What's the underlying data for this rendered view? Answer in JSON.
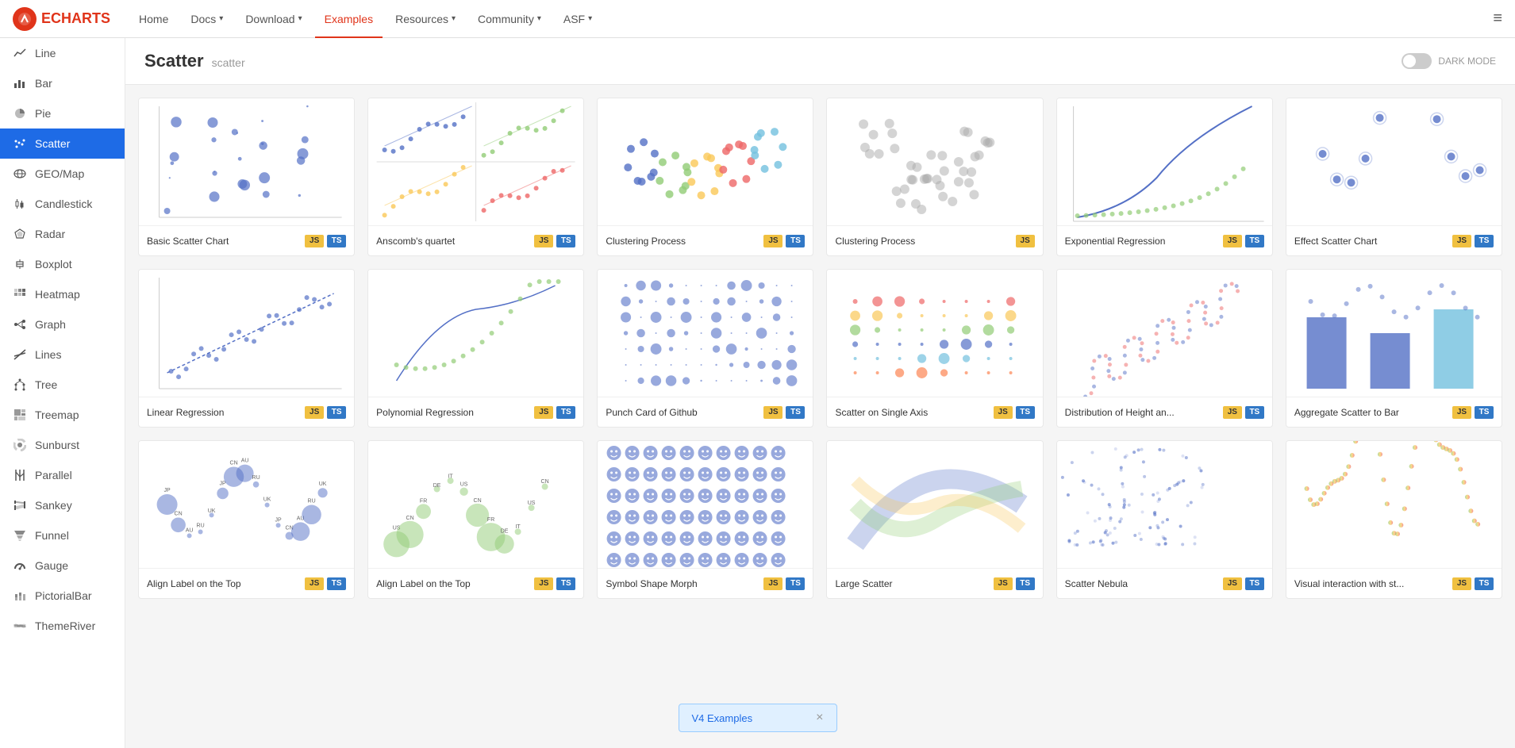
{
  "nav": {
    "logo_text": "ECHARTS",
    "links": [
      {
        "label": "Home",
        "active": false,
        "has_chevron": false
      },
      {
        "label": "Docs",
        "active": false,
        "has_chevron": true
      },
      {
        "label": "Download",
        "active": false,
        "has_chevron": true
      },
      {
        "label": "Examples",
        "active": true,
        "has_chevron": false
      },
      {
        "label": "Resources",
        "active": false,
        "has_chevron": true
      },
      {
        "label": "Community",
        "active": false,
        "has_chevron": true
      },
      {
        "label": "ASF",
        "active": false,
        "has_chevron": true
      }
    ]
  },
  "sidebar": {
    "items": [
      {
        "id": "line",
        "label": "Line",
        "icon": "📈",
        "active": false
      },
      {
        "id": "bar",
        "label": "Bar",
        "icon": "📊",
        "active": false
      },
      {
        "id": "pie",
        "label": "Pie",
        "icon": "🥧",
        "active": false
      },
      {
        "id": "scatter",
        "label": "Scatter",
        "icon": "⋯",
        "active": true
      },
      {
        "id": "geommap",
        "label": "GEO/Map",
        "icon": "🗺",
        "active": false
      },
      {
        "id": "candlestick",
        "label": "Candlestick",
        "icon": "📉",
        "active": false
      },
      {
        "id": "radar",
        "label": "Radar",
        "icon": "🕸",
        "active": false
      },
      {
        "id": "boxplot",
        "label": "Boxplot",
        "icon": "▭",
        "active": false
      },
      {
        "id": "heatmap",
        "label": "Heatmap",
        "icon": "▦",
        "active": false
      },
      {
        "id": "graph",
        "label": "Graph",
        "icon": "⬡",
        "active": false
      },
      {
        "id": "lines",
        "label": "Lines",
        "icon": "〜",
        "active": false
      },
      {
        "id": "tree",
        "label": "Tree",
        "icon": "🌲",
        "active": false
      },
      {
        "id": "treemap",
        "label": "Treemap",
        "icon": "▤",
        "active": false
      },
      {
        "id": "sunburst",
        "label": "Sunburst",
        "icon": "☀",
        "active": false
      },
      {
        "id": "parallel",
        "label": "Parallel",
        "icon": "∥",
        "active": false
      },
      {
        "id": "sankey",
        "label": "Sankey",
        "icon": "≡",
        "active": false
      },
      {
        "id": "funnel",
        "label": "Funnel",
        "icon": "⊻",
        "active": false
      },
      {
        "id": "gauge",
        "label": "Gauge",
        "icon": "⊙",
        "active": false
      },
      {
        "id": "pictorialbar",
        "label": "PictorialBar",
        "icon": "⊞",
        "active": false
      },
      {
        "id": "themeriver",
        "label": "ThemeRiver",
        "icon": "〜",
        "active": false
      }
    ]
  },
  "page": {
    "title": "Scatter",
    "subtitle": "scatter",
    "dark_mode_label": "DARK MODE"
  },
  "charts": [
    {
      "name": "Basic Scatter Chart",
      "has_js": true,
      "has_ts": true,
      "color_hint": "blue_dots"
    },
    {
      "name": "Anscomb's quartet",
      "has_js": true,
      "has_ts": true,
      "color_hint": "quartet"
    },
    {
      "name": "Clustering Process",
      "has_js": true,
      "has_ts": true,
      "color_hint": "colorful_clusters"
    },
    {
      "name": "Clustering Process",
      "has_js": true,
      "has_ts": false,
      "color_hint": "grey_clusters"
    },
    {
      "name": "Exponential Regression",
      "has_js": true,
      "has_ts": true,
      "color_hint": "regression_curve"
    },
    {
      "name": "Effect Scatter Chart",
      "has_js": true,
      "has_ts": true,
      "color_hint": "effect_scatter"
    },
    {
      "name": "Linear Regression",
      "has_js": true,
      "has_ts": true,
      "color_hint": "linear_regression"
    },
    {
      "name": "Polynomial Regression",
      "has_js": true,
      "has_ts": true,
      "color_hint": "poly_regression"
    },
    {
      "name": "Punch Card of Github",
      "has_js": true,
      "has_ts": true,
      "color_hint": "punch_card"
    },
    {
      "name": "Scatter on Single Axis",
      "has_js": true,
      "has_ts": true,
      "color_hint": "single_axis"
    },
    {
      "name": "Distribution of Height an...",
      "has_js": true,
      "has_ts": true,
      "color_hint": "height_weight"
    },
    {
      "name": "Aggregate Scatter to Bar",
      "has_js": true,
      "has_ts": true,
      "color_hint": "scatter_bar"
    },
    {
      "name": "Align Label on the Top",
      "has_js": true,
      "has_ts": true,
      "color_hint": "align_label_1"
    },
    {
      "name": "Align Label on the Top",
      "has_js": true,
      "has_ts": true,
      "color_hint": "align_label_2"
    },
    {
      "name": "Symbol Shape Morph",
      "has_js": true,
      "has_ts": true,
      "color_hint": "emoji_faces"
    },
    {
      "name": "Large Scatter",
      "has_js": true,
      "has_ts": true,
      "color_hint": "large_scatter"
    },
    {
      "name": "Scatter Nebula",
      "has_js": true,
      "has_ts": true,
      "color_hint": "nebula"
    },
    {
      "name": "Visual interaction with st...",
      "has_js": true,
      "has_ts": true,
      "color_hint": "visual_interaction"
    }
  ],
  "v4_banner": {
    "label": "V4 Examples",
    "close": "×"
  }
}
